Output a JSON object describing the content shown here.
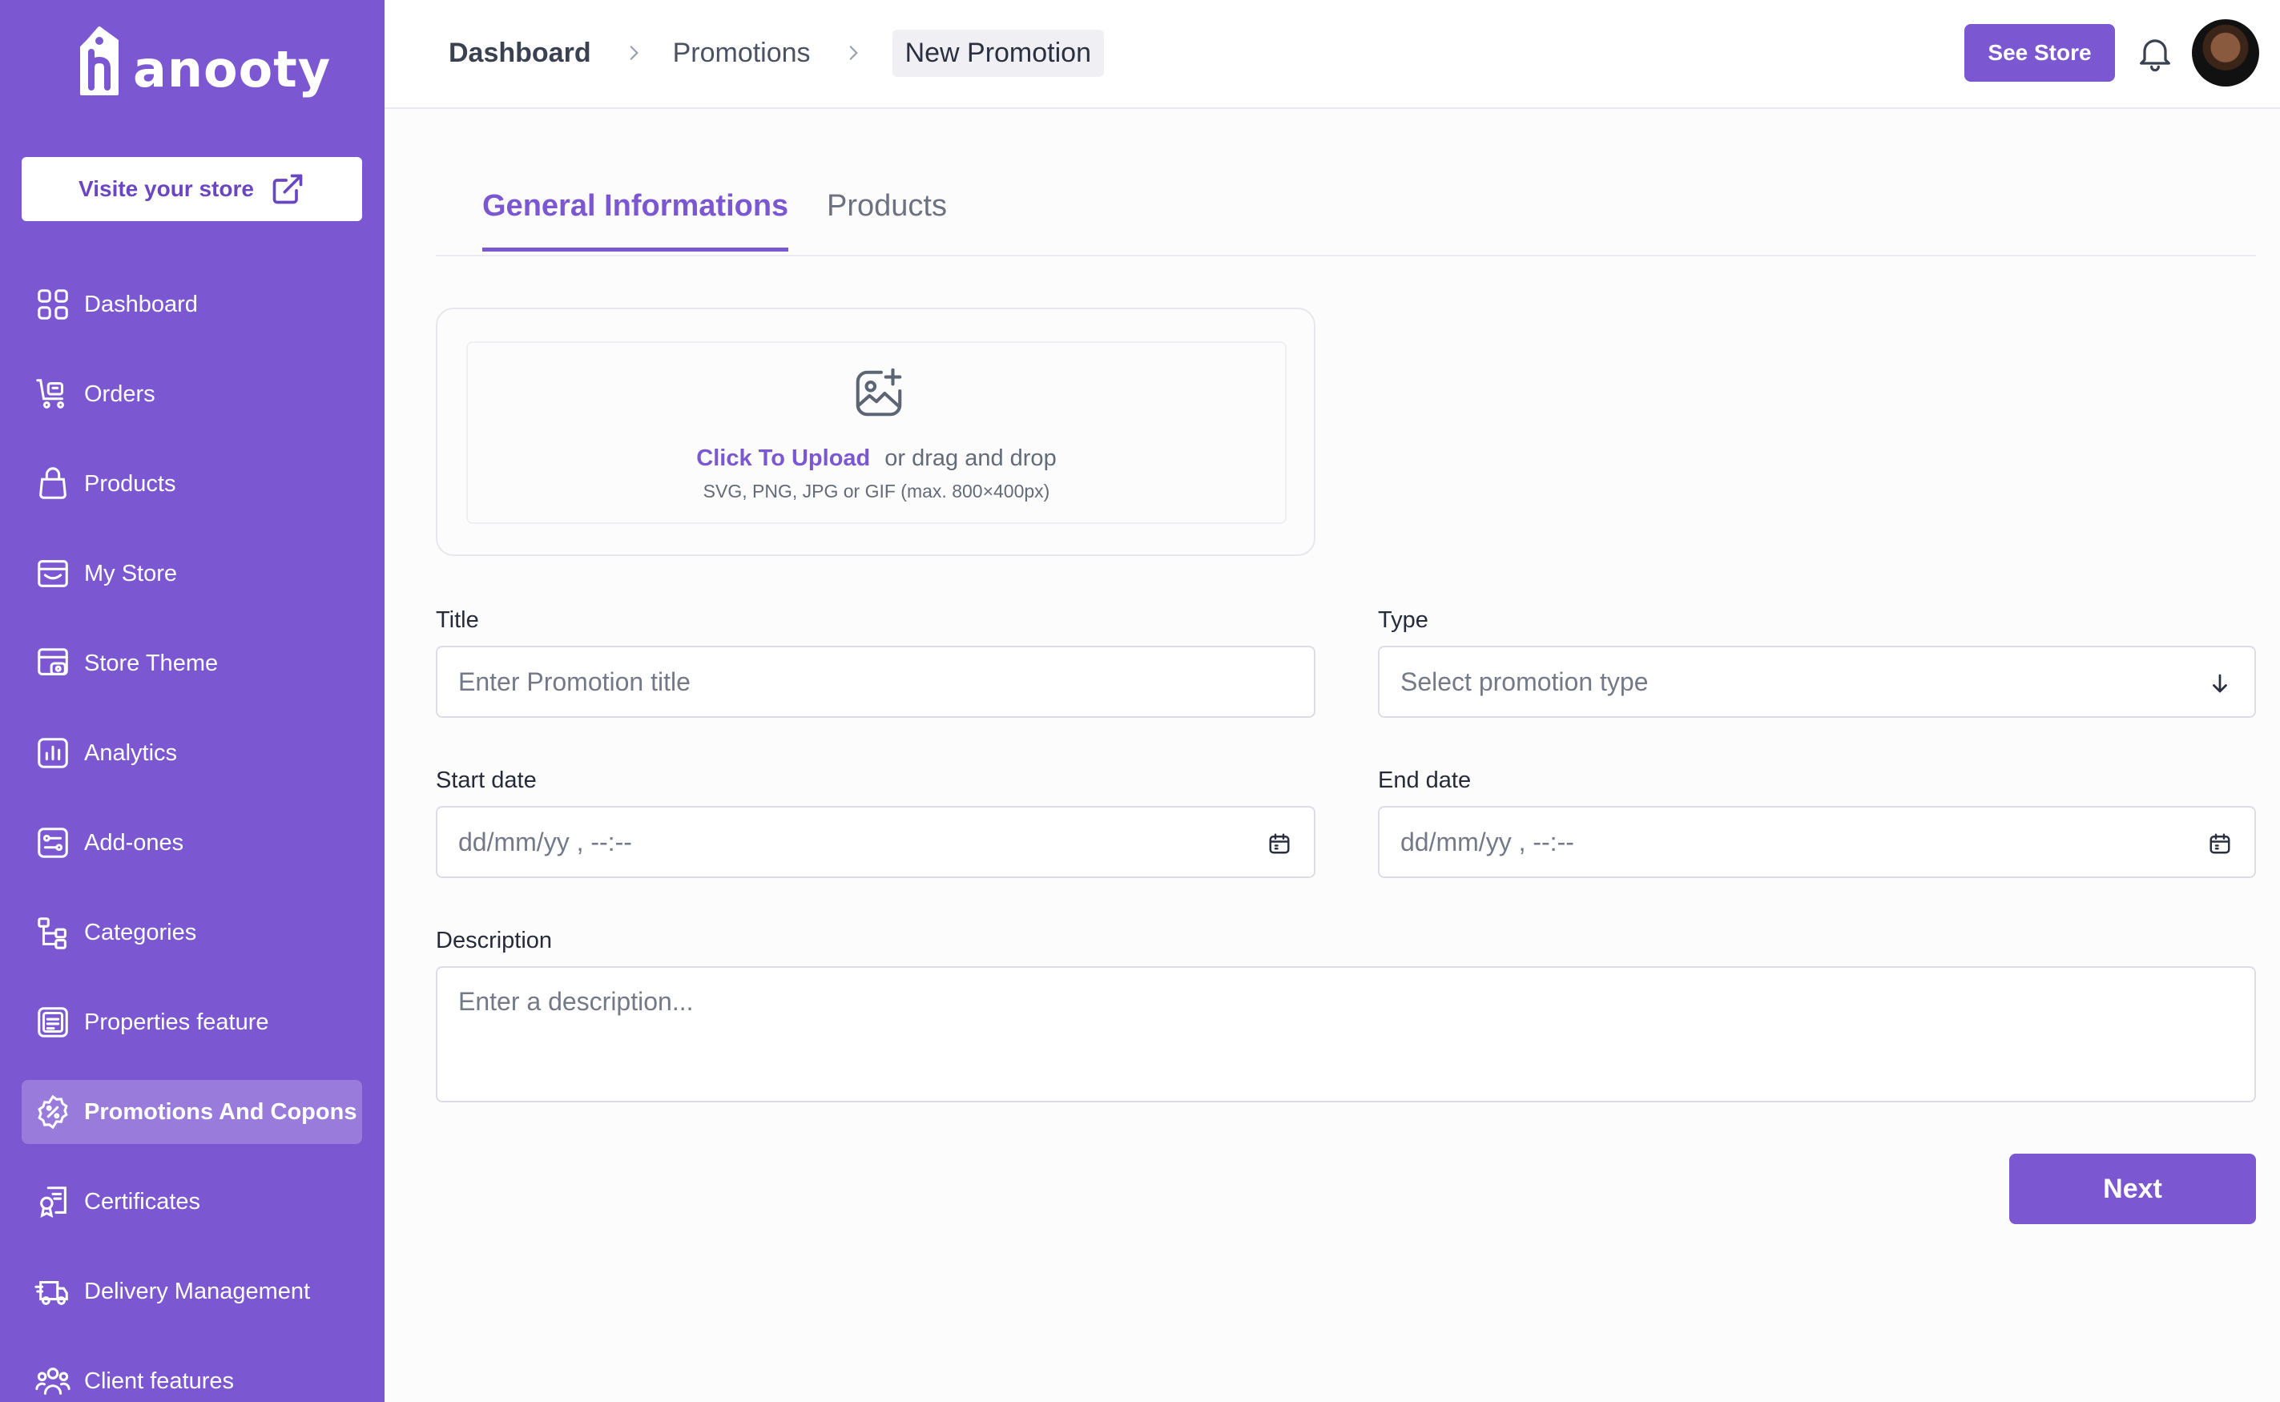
{
  "brand": {
    "name": "anooty",
    "accent": "#7b57d1",
    "sidebar_bg": "#7b57d1"
  },
  "sidebar": {
    "visit_store_label": "Visite your store",
    "items": [
      {
        "label": "Dashboard",
        "icon": "grid-icon"
      },
      {
        "label": "Orders",
        "icon": "cart-icon"
      },
      {
        "label": "Products",
        "icon": "bag-icon"
      },
      {
        "label": "My Store",
        "icon": "store-icon"
      },
      {
        "label": "Store Theme",
        "icon": "theme-icon"
      },
      {
        "label": "Analytics",
        "icon": "chart-icon"
      },
      {
        "label": "Add-ones",
        "icon": "addons-icon"
      },
      {
        "label": "Categories",
        "icon": "hierarchy-icon"
      },
      {
        "label": "Properties feature",
        "icon": "list-box-icon"
      },
      {
        "label": "Promotions And Copons",
        "icon": "percent-badge-icon",
        "active": true
      },
      {
        "label": "Certificates",
        "icon": "certificate-icon"
      },
      {
        "label": "Delivery Management",
        "icon": "truck-icon"
      },
      {
        "label": "Client features",
        "icon": "users-icon"
      }
    ]
  },
  "header": {
    "breadcrumb": [
      "Dashboard",
      "Promotions",
      "New Promotion"
    ],
    "see_store_label": "See Store"
  },
  "tabs": [
    {
      "label": "General Informations",
      "active": true
    },
    {
      "label": "Products",
      "active": false
    }
  ],
  "upload": {
    "link_text": "Click To Upload",
    "text": "or drag and drop",
    "hint": "SVG, PNG, JPG or GIF (max. 800×400px)"
  },
  "form": {
    "title": {
      "label": "Title",
      "placeholder": "Enter Promotion title"
    },
    "type": {
      "label": "Type",
      "placeholder": "Select promotion type"
    },
    "start_date": {
      "label": "Start date",
      "placeholder": "dd/mm/yy , --:--"
    },
    "end_date": {
      "label": "End date",
      "placeholder": "dd/mm/yy , --:--"
    },
    "description": {
      "label": "Description",
      "placeholder": "Enter a description..."
    }
  },
  "next_label": "Next"
}
